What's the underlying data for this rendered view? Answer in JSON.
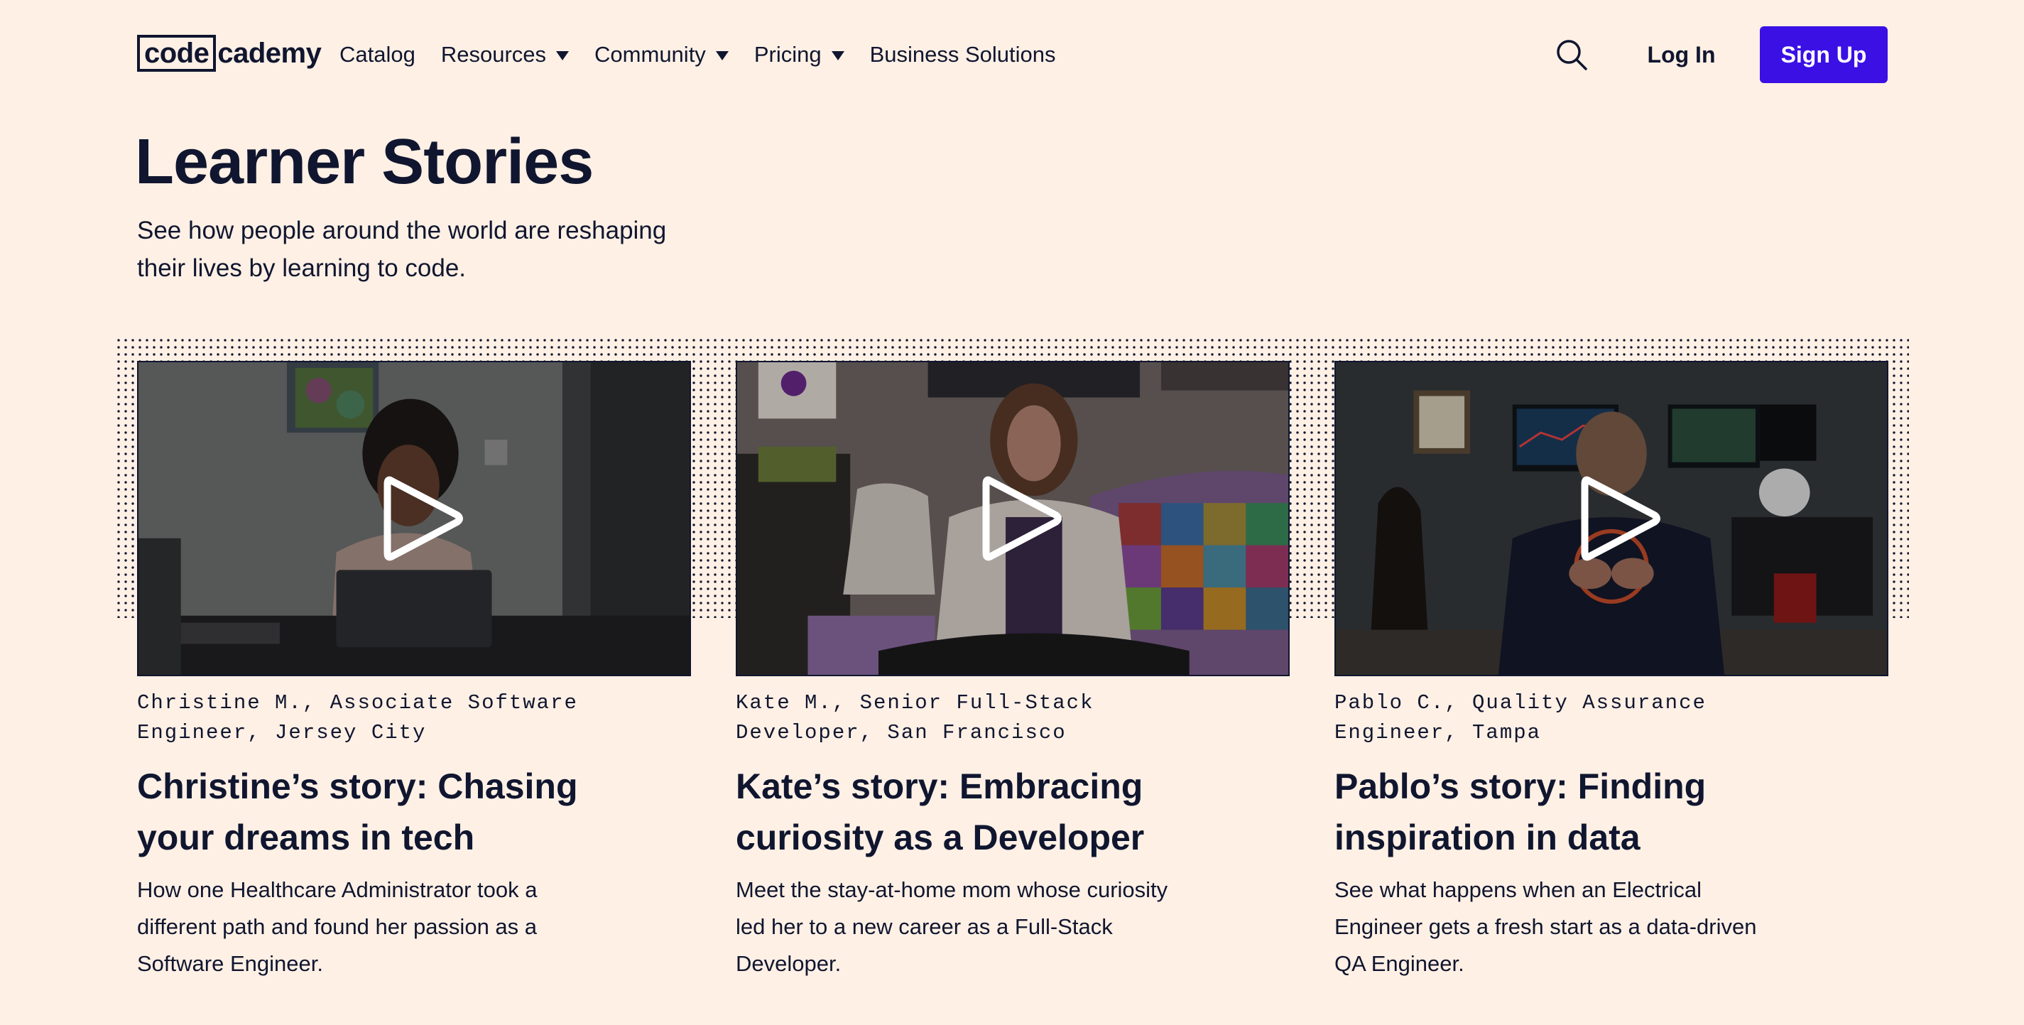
{
  "nav": {
    "logo_boxed": "code",
    "logo_rest": "cademy",
    "links": [
      {
        "label": "Catalog",
        "dropdown": false
      },
      {
        "label": "Resources",
        "dropdown": true
      },
      {
        "label": "Community",
        "dropdown": true
      },
      {
        "label": "Pricing",
        "dropdown": true
      },
      {
        "label": "Business Solutions",
        "dropdown": false
      }
    ],
    "login_label": "Log In",
    "signup_label": "Sign Up"
  },
  "header": {
    "title": "Learner Stories",
    "subtitle": "See how people around the world are reshaping their lives by learning to code."
  },
  "colors": {
    "background": "#fff0e5",
    "text": "#10162f",
    "accent": "#3a10e5"
  },
  "stories": [
    {
      "meta": "Christine M., Associate Software Engineer, Jersey City",
      "headline": "Christine’s story: Chasing your dreams in tech",
      "description": "How one Healthcare Administrator took a different path and found her passion as a Software Engineer."
    },
    {
      "meta": "Kate M., Senior Full-Stack Developer, San Francisco",
      "headline": "Kate’s story: Embracing curiosity as a Developer",
      "description": "Meet the stay-at-home mom whose curiosity led her to a new career as a Full-Stack Developer."
    },
    {
      "meta": "Pablo C., Quality Assurance Engineer, Tampa",
      "headline": "Pablo’s story: Finding inspiration in data",
      "description": "See what happens when an Electrical Engineer gets a fresh start as a data-driven QA Engineer."
    }
  ]
}
